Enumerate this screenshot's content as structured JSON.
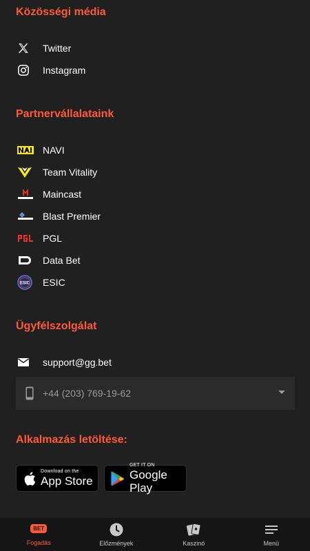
{
  "social": {
    "title": "Közösségi média",
    "items": [
      {
        "label": "Twitter",
        "icon": "x-twitter-icon"
      },
      {
        "label": "Instagram",
        "icon": "instagram-icon"
      }
    ]
  },
  "partners": {
    "title": "Partnervállalataink",
    "items": [
      {
        "label": "NAVI",
        "icon": "navi-logo-icon"
      },
      {
        "label": "Team Vitality",
        "icon": "vitality-logo-icon"
      },
      {
        "label": "Maincast",
        "icon": "maincast-logo-icon"
      },
      {
        "label": "Blast Premier",
        "icon": "blast-premier-logo-icon"
      },
      {
        "label": "PGL",
        "icon": "pgl-logo-icon"
      },
      {
        "label": "Data Bet",
        "icon": "databet-logo-icon"
      },
      {
        "label": "ESIC",
        "icon": "esic-logo-icon"
      }
    ]
  },
  "support": {
    "title": "Ügyfélszolgálat",
    "email": "support@gg.bet",
    "phone": "+44 (203) 769-19-62"
  },
  "apps": {
    "title": "Alkalmazás letöltése:",
    "appstore_small": "Download on the",
    "appstore_big": "App Store",
    "googleplay_small": "GET IT ON",
    "googleplay_big": "Google Play"
  },
  "nav": {
    "badge": "BET",
    "items": [
      {
        "label": "Fogadás",
        "active": true
      },
      {
        "label": "Előzmények",
        "active": false
      },
      {
        "label": "Kaszinó",
        "active": false
      },
      {
        "label": "Menü",
        "active": false
      }
    ]
  },
  "colors": {
    "accent": "#ff5a36",
    "background": "#202020",
    "nav_background": "#151515"
  }
}
